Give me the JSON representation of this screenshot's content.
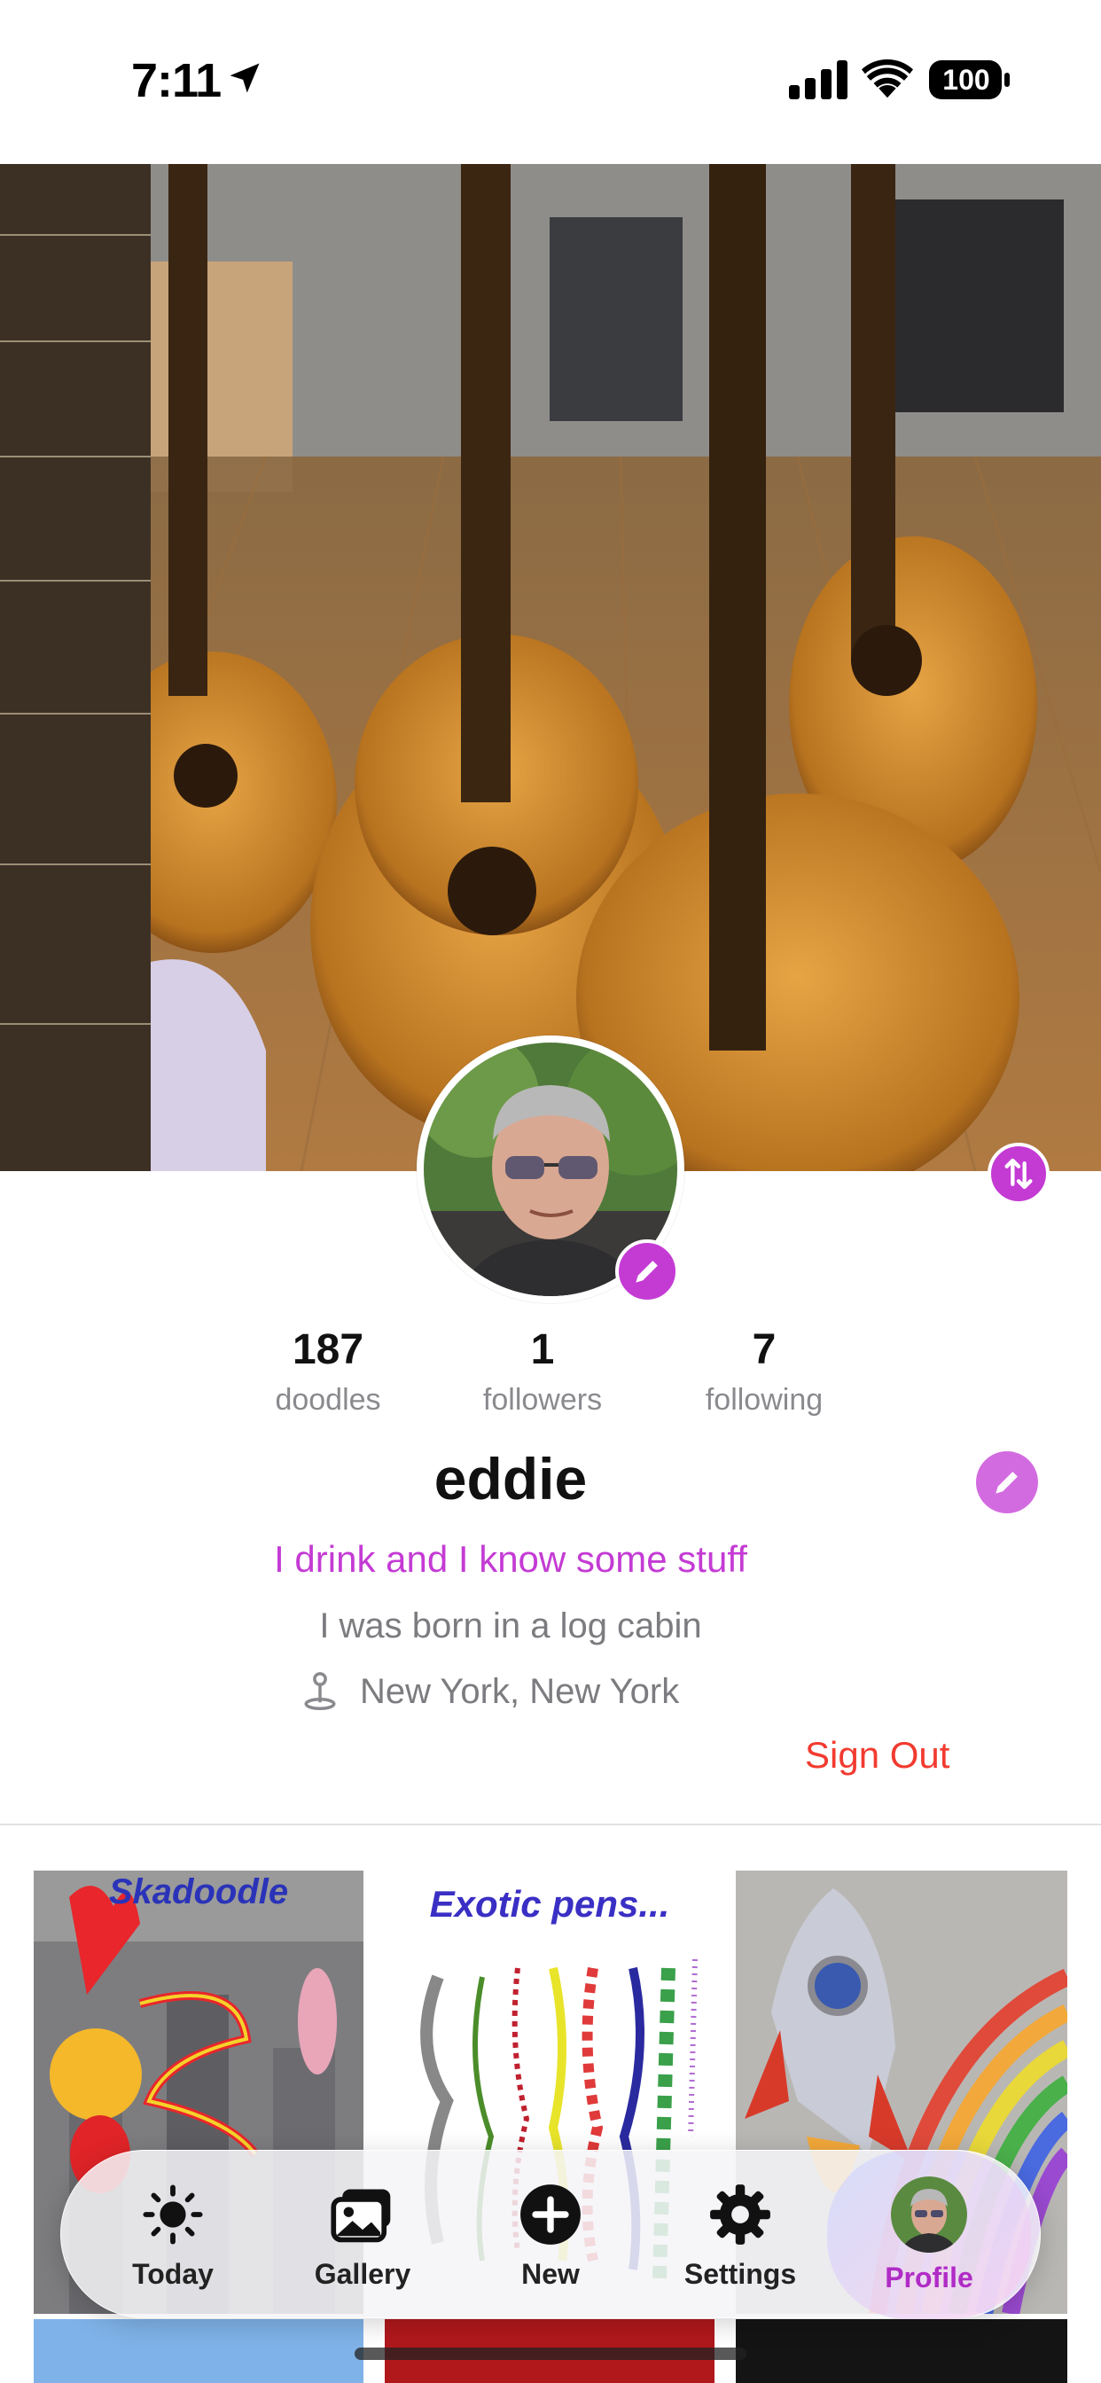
{
  "status_bar": {
    "time": "7:11",
    "battery": "100"
  },
  "profile": {
    "stats": [
      {
        "value": "187",
        "label": "doodles"
      },
      {
        "value": "1",
        "label": "followers"
      },
      {
        "value": "7",
        "label": "following"
      }
    ],
    "username": "eddie",
    "tagline": "I drink and I know some stuff",
    "bio": "I was born in a log cabin",
    "location": "New York, New York",
    "sign_out_label": "Sign Out"
  },
  "gallery": {
    "tiles": [
      {
        "title": "Skadoodle",
        "title_color": "#2a33b8"
      },
      {
        "title": "Exotic pens...",
        "title_color": "#3a2fc4"
      },
      {
        "title": ""
      }
    ]
  },
  "tabbar": {
    "items": [
      {
        "label": "Today",
        "icon": "sun-icon"
      },
      {
        "label": "Gallery",
        "icon": "photos-icon"
      },
      {
        "label": "New",
        "icon": "plus-circle-icon"
      },
      {
        "label": "Settings",
        "icon": "gear-icon"
      },
      {
        "label": "Profile",
        "icon": "avatar-icon"
      }
    ],
    "active": "Profile"
  },
  "colors": {
    "accent": "#c43bd4",
    "signout": "#f23b30",
    "muted": "#7c7c80"
  }
}
